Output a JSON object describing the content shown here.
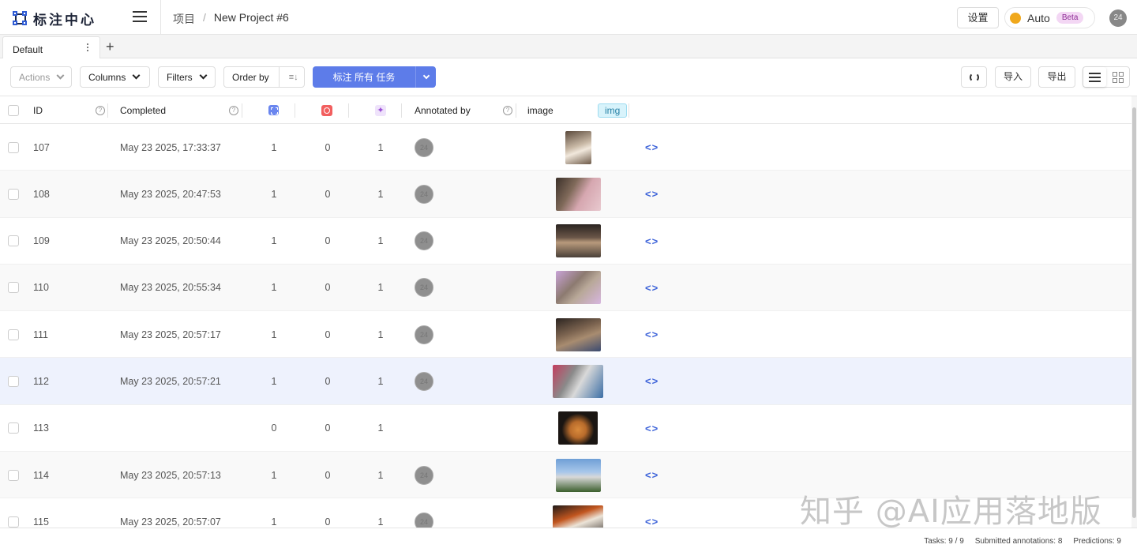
{
  "header": {
    "logo_text": "标注中心",
    "breadcrumb": [
      "项目",
      "New Project #6"
    ],
    "breadcrumb_sep": "/",
    "settings_label": "设置",
    "theme_label": "Auto",
    "beta_label": "Beta",
    "avatar_initials": "24",
    "colors": {
      "brand": "#2f5bd3",
      "theme_dot": "#f0a81c"
    }
  },
  "tabs": {
    "items": [
      {
        "label": "Default"
      }
    ],
    "add_label": "+"
  },
  "toolbar": {
    "actions_label": "Actions",
    "columns_label": "Columns",
    "filters_label": "Filters",
    "order_by_label": "Order by",
    "label_all_label": "标注 所有 任务",
    "import_label": "导入",
    "export_label": "导出",
    "colors": {
      "primary": "#5d7ce9"
    }
  },
  "table": {
    "columns": {
      "id": "ID",
      "completed": "Completed",
      "annotated_by": "Annotated by",
      "image": "image",
      "image_tag": "img"
    },
    "rows": [
      {
        "id": "107",
        "completed": "May 23 2025, 17:33:37",
        "total": "1",
        "cancelled": "0",
        "predictions": "1",
        "annotator": "24",
        "image": "cat-1"
      },
      {
        "id": "108",
        "completed": "May 23 2025, 20:47:53",
        "total": "1",
        "cancelled": "0",
        "predictions": "1",
        "annotator": "24",
        "image": "cat-2"
      },
      {
        "id": "109",
        "completed": "May 23 2025, 20:50:44",
        "total": "1",
        "cancelled": "0",
        "predictions": "1",
        "annotator": "24",
        "image": "cat-3"
      },
      {
        "id": "110",
        "completed": "May 23 2025, 20:55:34",
        "total": "1",
        "cancelled": "0",
        "predictions": "1",
        "annotator": "24",
        "image": "cat-4"
      },
      {
        "id": "111",
        "completed": "May 23 2025, 20:57:17",
        "total": "1",
        "cancelled": "0",
        "predictions": "1",
        "annotator": "24",
        "image": "cat-5"
      },
      {
        "id": "112",
        "completed": "May 23 2025, 20:57:21",
        "total": "1",
        "cancelled": "0",
        "predictions": "1",
        "annotator": "24",
        "image": "cat-6"
      },
      {
        "id": "113",
        "completed": "",
        "total": "0",
        "cancelled": "0",
        "predictions": "1",
        "annotator": "",
        "image": "cat-7"
      },
      {
        "id": "114",
        "completed": "May 23 2025, 20:57:13",
        "total": "1",
        "cancelled": "0",
        "predictions": "1",
        "annotator": "24",
        "image": "cat-8"
      },
      {
        "id": "115",
        "completed": "May 23 2025, 20:57:07",
        "total": "1",
        "cancelled": "0",
        "predictions": "1",
        "annotator": "24",
        "image": "cat-9"
      }
    ]
  },
  "footer": {
    "tasks": "Tasks: 9 / 9",
    "submitted": "Submitted annotations: 8",
    "predictions": "Predictions: 9"
  },
  "watermark": "知乎 @AI应用落地版"
}
